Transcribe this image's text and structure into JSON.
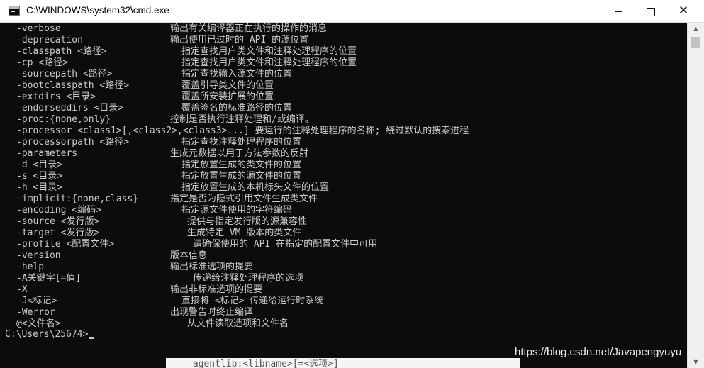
{
  "window": {
    "title": "C:\\WINDOWS\\system32\\cmd.exe",
    "controls": {
      "minimize_icon": "minimize-icon",
      "maximize_icon": "maximize-icon",
      "close_icon": "close-icon",
      "close_glyph": "✕"
    }
  },
  "console": {
    "lines": [
      {
        "opt": "-verbose",
        "desc": "输出有关编译器正在执行的操作的消息"
      },
      {
        "opt": "-deprecation",
        "desc": "输出使用已过时的 API 的源位置"
      },
      {
        "opt": "-classpath <路径>",
        "desc": "指定查找用户类文件和注释处理程序的位置"
      },
      {
        "opt": "-cp <路径>",
        "desc": "指定查找用户类文件和注释处理程序的位置"
      },
      {
        "opt": "-sourcepath <路径>",
        "desc": "指定查找输入源文件的位置"
      },
      {
        "opt": "-bootclasspath <路径>",
        "desc": "覆盖引导类文件的位置"
      },
      {
        "opt": "-extdirs <目录>",
        "desc": "覆盖所安装扩展的位置"
      },
      {
        "opt": "-endorseddirs <目录>",
        "desc": "覆盖签名的标准路径的位置"
      },
      {
        "opt": "-proc:{none,only}",
        "desc": "控制是否执行注释处理和/或编译。"
      },
      {
        "opt": "-processor <class1>[,<class2>,<class3>...]",
        "desc": "要运行的注释处理程序的名称; 绕过默认的搜索进程"
      },
      {
        "opt": "-processorpath <路径>",
        "desc": "指定查找注释处理程序的位置"
      },
      {
        "opt": "-parameters",
        "desc": "生成元数据以用于方法参数的反射"
      },
      {
        "opt": "-d <目录>",
        "desc": "指定放置生成的类文件的位置"
      },
      {
        "opt": "-s <目录>",
        "desc": "指定放置生成的源文件的位置"
      },
      {
        "opt": "-h <目录>",
        "desc": "指定放置生成的本机标头文件的位置"
      },
      {
        "opt": "-implicit:{none,class}",
        "desc": "指定是否为隐式引用文件生成类文件"
      },
      {
        "opt": "-encoding <编码>",
        "desc": "指定源文件使用的字符编码"
      },
      {
        "opt": "-source <发行版>",
        "desc": "提供与指定发行版的源兼容性"
      },
      {
        "opt": "-target <发行版>",
        "desc": "生成特定 VM 版本的类文件"
      },
      {
        "opt": "-profile <配置文件>",
        "desc": "请确保使用的 API 在指定的配置文件中可用"
      },
      {
        "opt": "-version",
        "desc": "版本信息"
      },
      {
        "opt": "-help",
        "desc": "输出标准选项的提要"
      },
      {
        "opt": "-A关键字[=值]",
        "desc": "传递给注释处理程序的选项"
      },
      {
        "opt": "-X",
        "desc": "输出非标准选项的提要"
      },
      {
        "opt": "-J<标记>",
        "desc": "直接将 <标记> 传递给运行时系统"
      },
      {
        "opt": "-Werror",
        "desc": "出现警告时终止编译"
      },
      {
        "opt": "@<文件名>",
        "desc": "从文件读取选项和文件名"
      }
    ],
    "prompt": "C:\\Users\\25674>"
  },
  "scrollbar": {
    "up_icon": "scroll-up-arrow-icon",
    "down_icon": "scroll-down-arrow-icon"
  },
  "watermark": "https://blog.csdn.net/Javapengyuyu",
  "underlay_text": "-agentlib:<libname>[=<选项>]",
  "colors": {
    "console_bg": "#0c0c0c",
    "console_text": "#cccccc",
    "titlebar_bg": "#ffffff"
  }
}
